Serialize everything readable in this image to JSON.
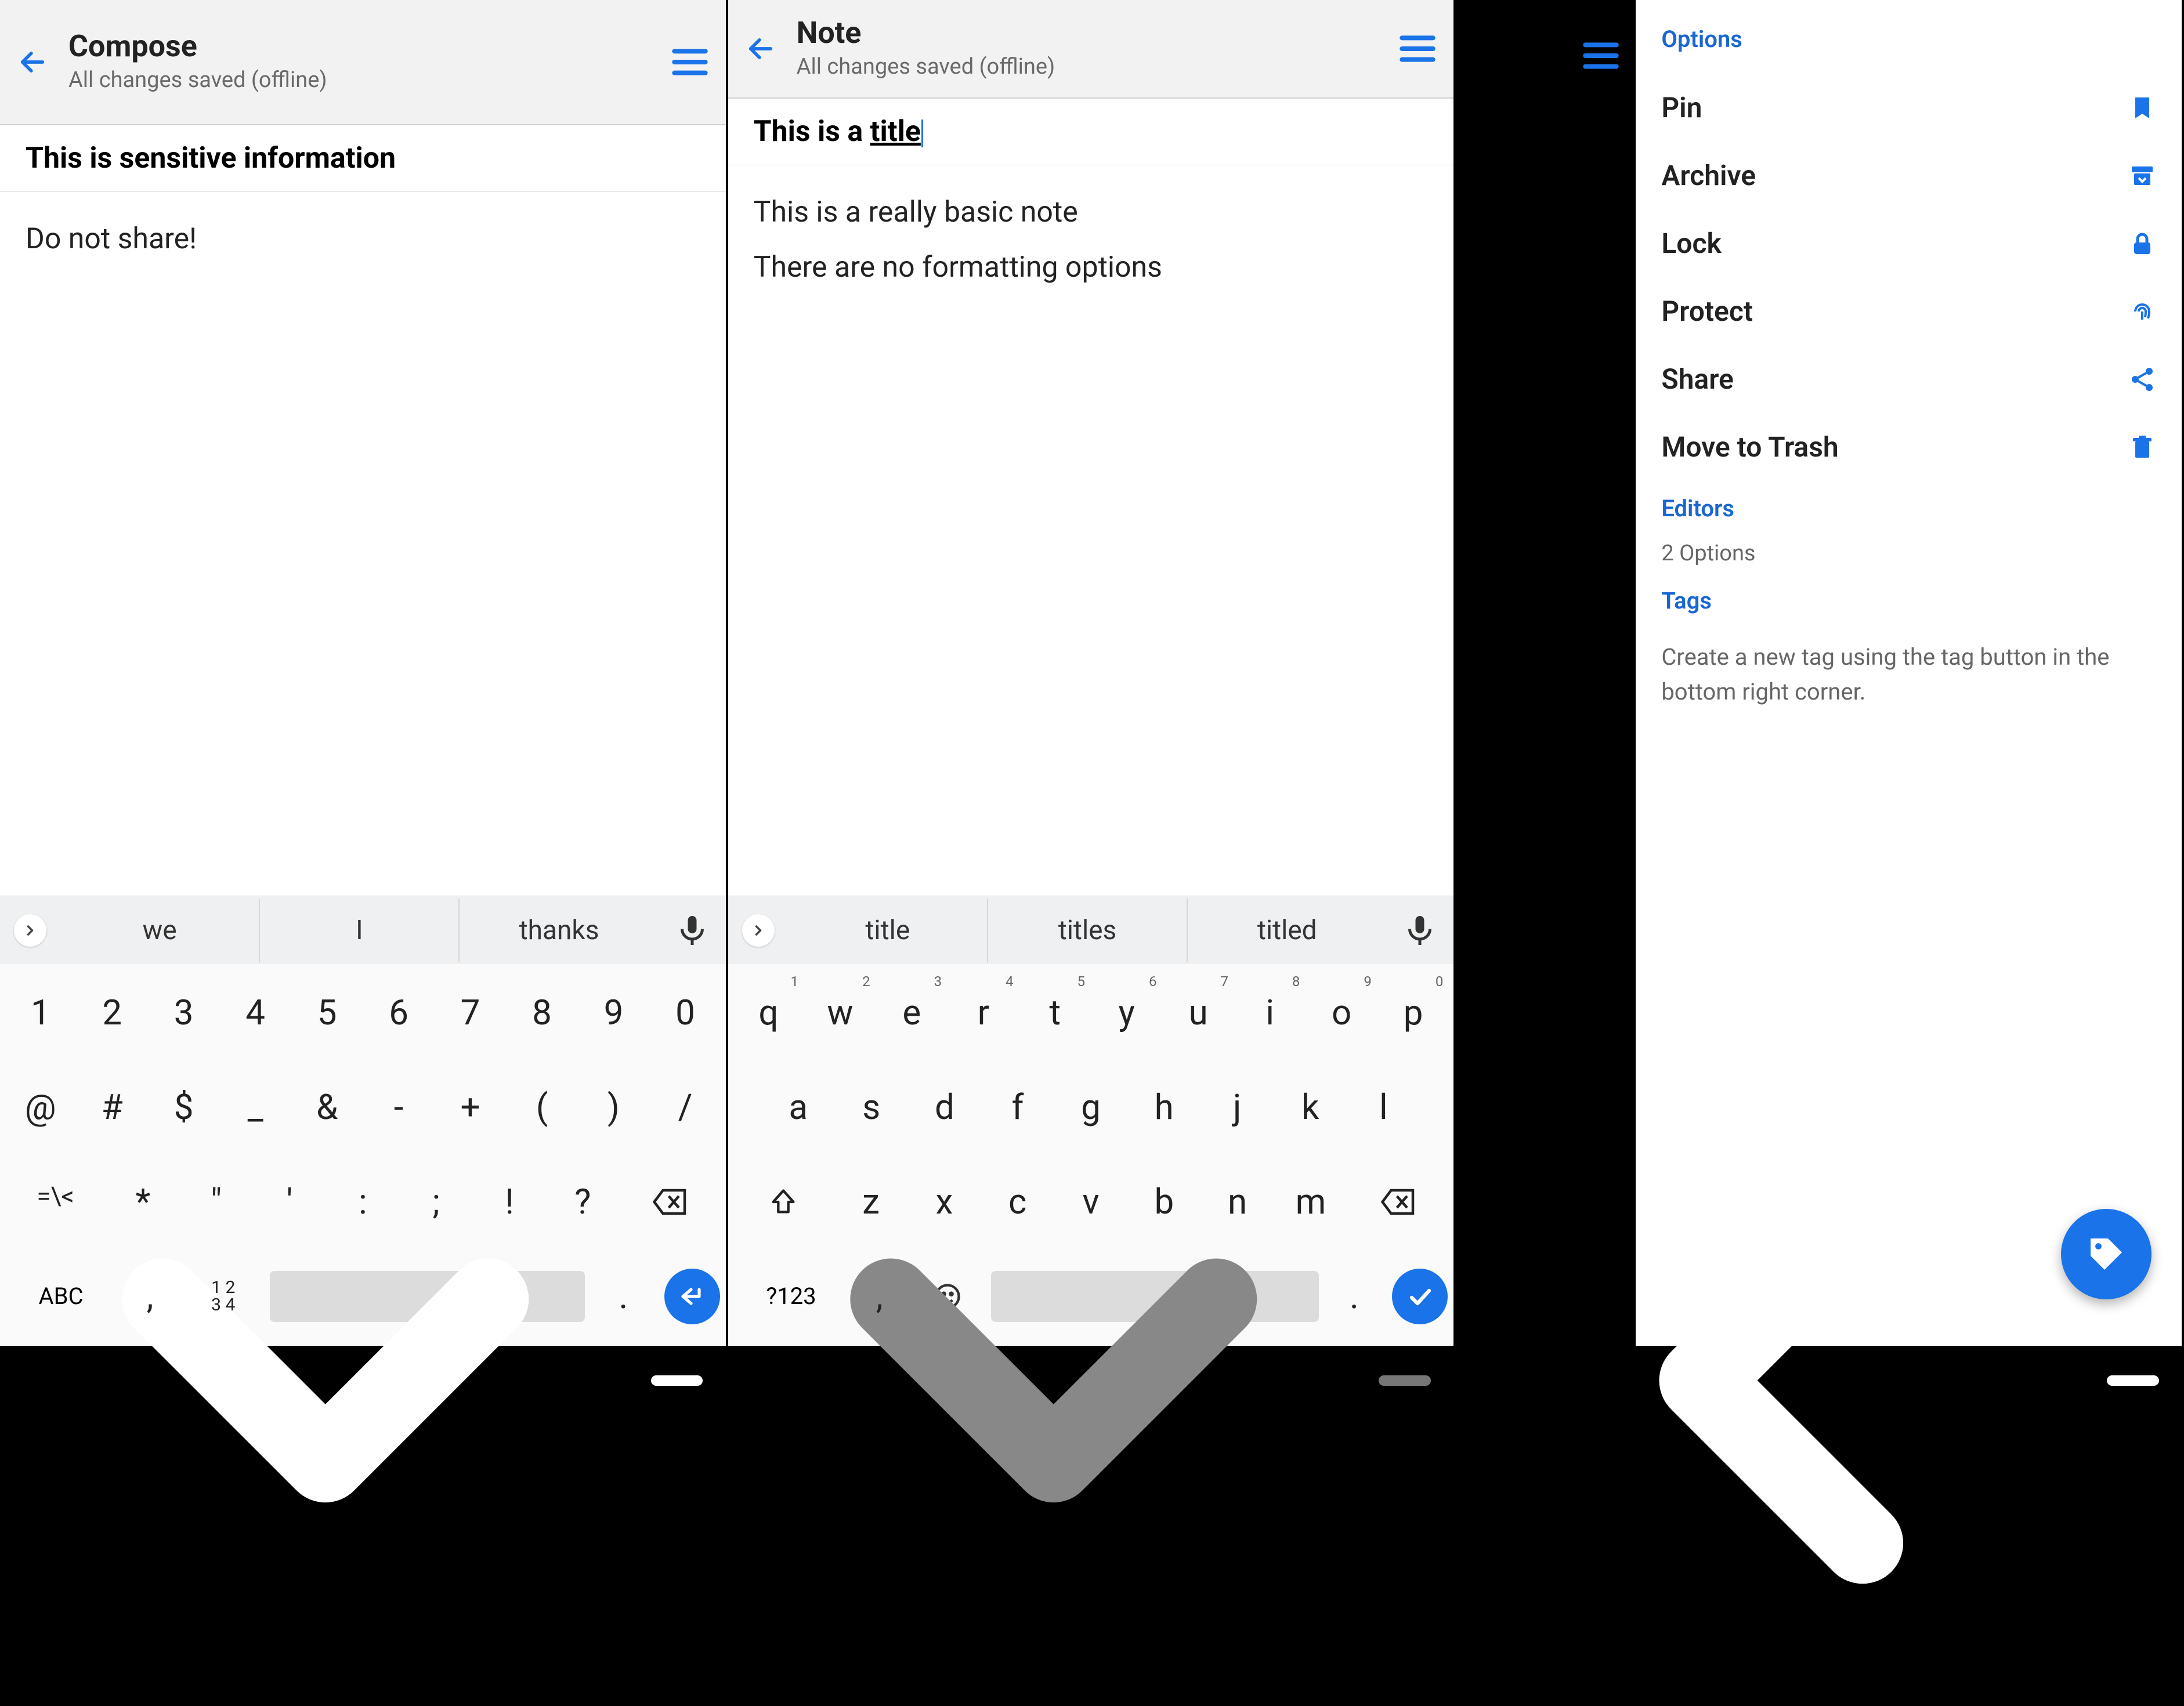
{
  "screen1": {
    "appbar": {
      "title": "Compose",
      "subtitle": "All changes saved (offline)"
    },
    "note_title": "This is sensitive information",
    "note_body": "Do not share!",
    "suggestions": [
      "we",
      "I",
      "thanks"
    ],
    "keyboard_rows": {
      "r1": [
        "1",
        "2",
        "3",
        "4",
        "5",
        "6",
        "7",
        "8",
        "9",
        "0"
      ],
      "r2": [
        "@",
        "#",
        "$",
        "_",
        "&",
        "-",
        "+",
        "(",
        ")",
        "/"
      ],
      "r3": [
        "=\\<",
        "*",
        "\"",
        "'",
        ":",
        ";",
        "!",
        "?"
      ],
      "r4_switch": "ABC",
      "r4_numblock": "1 2\n3 4"
    }
  },
  "screen2": {
    "appbar": {
      "title": "Note",
      "subtitle": "All changes saved (offline)"
    },
    "note_title_plain": "This is a ",
    "note_title_underlined": "title",
    "note_body_line1": "This is a really basic note",
    "note_body_line2": "There are no formatting options",
    "suggestions": [
      "title",
      "titles",
      "titled"
    ],
    "keyboard_rows": {
      "r1": [
        [
          "q",
          "1"
        ],
        [
          "w",
          "2"
        ],
        [
          "e",
          "3"
        ],
        [
          "r",
          "4"
        ],
        [
          "t",
          "5"
        ],
        [
          "y",
          "6"
        ],
        [
          "u",
          "7"
        ],
        [
          "i",
          "8"
        ],
        [
          "o",
          "9"
        ],
        [
          "p",
          "0"
        ]
      ],
      "r2": [
        "a",
        "s",
        "d",
        "f",
        "g",
        "h",
        "j",
        "k",
        "l"
      ],
      "r3": [
        "z",
        "x",
        "c",
        "v",
        "b",
        "n",
        "m"
      ],
      "r4_switch": "?123"
    }
  },
  "screen3": {
    "sections": {
      "options_title": "Options",
      "options_items": [
        {
          "label": "Pin",
          "icon": "bookmark"
        },
        {
          "label": "Archive",
          "icon": "archive"
        },
        {
          "label": "Lock",
          "icon": "lock"
        },
        {
          "label": "Protect",
          "icon": "fingerprint"
        },
        {
          "label": "Share",
          "icon": "share"
        },
        {
          "label": "Move to Trash",
          "icon": "trash"
        }
      ],
      "editors_title": "Editors",
      "editors_subtitle": "2 Options",
      "tags_title": "Tags",
      "tags_help": "Create a new tag using the tag button in the bottom right corner."
    }
  },
  "colors": {
    "accent": "#1a73e8"
  }
}
